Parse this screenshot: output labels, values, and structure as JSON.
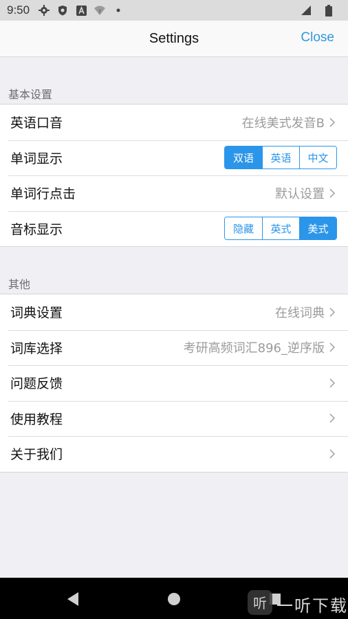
{
  "status_bar": {
    "time": "9:50",
    "icons": [
      "gear-icon",
      "shield-icon",
      "a-icon",
      "wifi-question-icon",
      "dot-icon"
    ],
    "right_icons": [
      "signal-icon",
      "battery-icon"
    ]
  },
  "header": {
    "title": "Settings",
    "close_label": "Close",
    "accent_color": "#2e97e0"
  },
  "sections": {
    "basic": {
      "title": "基本设置",
      "rows": {
        "pronunciation": {
          "label": "英语口音",
          "value": "在线美式发音B"
        },
        "word_display": {
          "label": "单词显示",
          "options": [
            "双语",
            "英语",
            "中文"
          ],
          "selected": "双语"
        },
        "row_click": {
          "label": "单词行点击",
          "value": "默认设置"
        },
        "phonetic": {
          "label": "音标显示",
          "options": [
            "隐藏",
            "英式",
            "美式"
          ],
          "selected": "美式"
        }
      }
    },
    "other": {
      "title": "其他",
      "rows": {
        "dictionary": {
          "label": "词典设置",
          "value": "在线词典"
        },
        "wordbank": {
          "label": "词库选择",
          "value": "考研高频词汇896_逆序版"
        },
        "feedback": {
          "label": "问题反馈"
        },
        "tutorial": {
          "label": "使用教程"
        },
        "about": {
          "label": "关于我们"
        }
      }
    }
  },
  "nav_bar": {
    "icons": [
      "back-icon",
      "home-icon",
      "recents-icon"
    ]
  },
  "watermark": {
    "text": "一听下载"
  }
}
